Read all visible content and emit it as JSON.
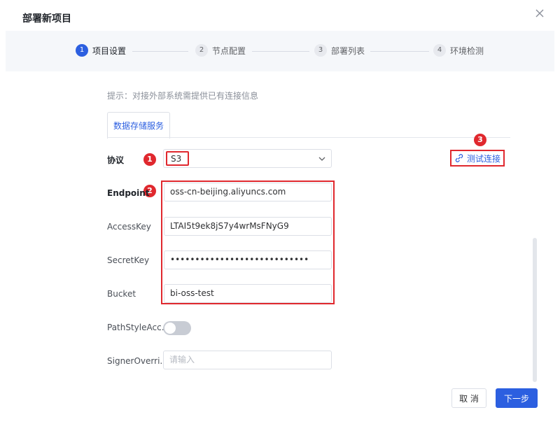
{
  "dialog": {
    "title": "部署新项目"
  },
  "steps": [
    {
      "number": "1",
      "label": "项目设置"
    },
    {
      "number": "2",
      "label": "节点配置"
    },
    {
      "number": "3",
      "label": "部署列表"
    },
    {
      "number": "4",
      "label": "环境检测"
    }
  ],
  "active_step": "1",
  "hint": "提示：对接外部系统需提供已有连接信息",
  "tab": {
    "label": "数据存储服务"
  },
  "form": {
    "protocol": {
      "label": "协议",
      "value": "S3"
    },
    "endpoint": {
      "label": "Endpoint",
      "value": "oss-cn-beijing.aliyuncs.com"
    },
    "access_key": {
      "label": "AccessKey",
      "value": "LTAI5t9ek8jS7y4wrMsFNyG9"
    },
    "secret_key": {
      "label": "SecretKey",
      "value": "••••••••••••••••••••••••••••"
    },
    "bucket": {
      "label": "Bucket",
      "value": "bi-oss-test"
    },
    "path_style": {
      "label": "PathStyleAcc...",
      "enabled": false
    },
    "signer_override": {
      "label": "SignerOverri...",
      "placeholder": "请输入"
    }
  },
  "test_connection": {
    "label": "测试连接"
  },
  "annotations": [
    "1",
    "2",
    "3"
  ],
  "buttons": {
    "cancel": "取 消",
    "next": "下一步"
  },
  "colors": {
    "primary": "#2c5fe0",
    "annotation_red": "#e0282e",
    "panel_bg": "#f5f7fa"
  }
}
